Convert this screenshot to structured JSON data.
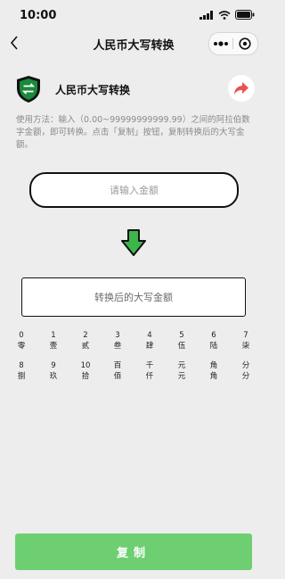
{
  "status": {
    "time": "10:00"
  },
  "nav": {
    "title": "人民币大写转换"
  },
  "header": {
    "title": "人民币大写转换"
  },
  "instructions": "使用方法：输入（0.00~99999999999.99）之间的阿拉伯数字金额，即可转换。点击「复制」按钮，复制转换后的大写金额。",
  "input": {
    "placeholder": "请输入金额"
  },
  "result": {
    "placeholder": "转换后的大写金额"
  },
  "digit_rows": [
    [
      [
        "0",
        "零"
      ],
      [
        "1",
        "壹"
      ],
      [
        "2",
        "贰"
      ],
      [
        "3",
        "叁"
      ],
      [
        "4",
        "肆"
      ],
      [
        "5",
        "伍"
      ],
      [
        "6",
        "陆"
      ],
      [
        "7",
        "柒"
      ]
    ],
    [
      [
        "8",
        "捌"
      ],
      [
        "9",
        "玖"
      ],
      [
        "10",
        "拾"
      ],
      [
        "百",
        "佰"
      ],
      [
        "千",
        "仟"
      ],
      [
        "元",
        "元"
      ],
      [
        "角",
        "角"
      ],
      [
        "分",
        "分"
      ]
    ]
  ],
  "copy_button": {
    "label": "复制"
  },
  "colors": {
    "accent": "#6dcf72",
    "arrow": "#3cb64a",
    "share": "#e9524e",
    "shield": "#1a8a3a"
  }
}
